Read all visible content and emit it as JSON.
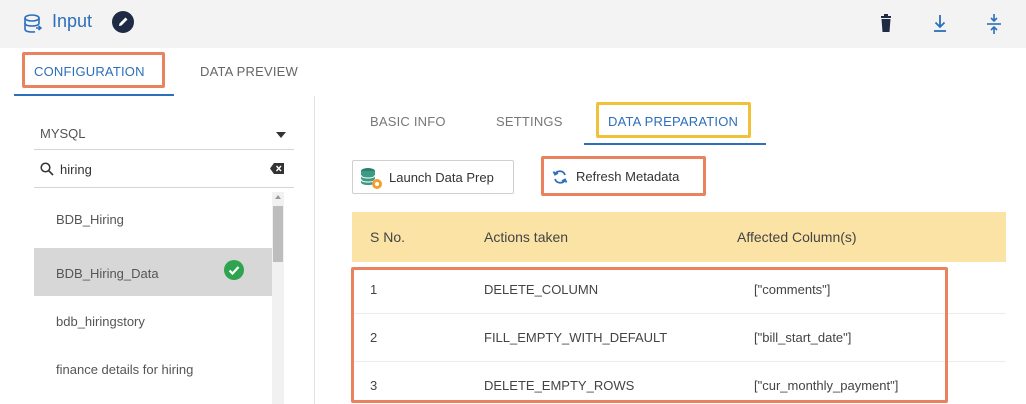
{
  "header": {
    "title": "Input",
    "icons": [
      "database-icon",
      "edit-icon",
      "trash-icon",
      "download-icon",
      "collapse-icon"
    ]
  },
  "top_tabs": [
    {
      "label": "CONFIGURATION",
      "active": true
    },
    {
      "label": "DATA PREVIEW",
      "active": false
    }
  ],
  "left": {
    "select_value": "MYSQL",
    "search_value": "hiring",
    "items": [
      {
        "label": "BDB_Hiring",
        "selected": false
      },
      {
        "label": "BDB_Hiring_Data",
        "selected": true
      },
      {
        "label": "bdb_hiringstory",
        "selected": false
      },
      {
        "label": "finance details for hiring",
        "selected": false
      }
    ]
  },
  "sub_tabs": [
    {
      "label": "BASIC INFO",
      "active": false
    },
    {
      "label": "SETTINGS",
      "active": false
    },
    {
      "label": "DATA PREPARATION",
      "active": true
    }
  ],
  "buttons": {
    "launch": "Launch Data Prep",
    "refresh": "Refresh Metadata"
  },
  "table": {
    "headers": [
      "S No.",
      "Actions taken",
      "Affected Column(s)"
    ],
    "rows": [
      [
        "1",
        "DELETE_COLUMN",
        "[\"comments\"]"
      ],
      [
        "2",
        "FILL_EMPTY_WITH_DEFAULT",
        "[\"bill_start_date\"]"
      ],
      [
        "3",
        "DELETE_EMPTY_ROWS",
        "[\"cur_monthly_payment\"]"
      ]
    ]
  },
  "colors": {
    "accent": "#2c6fbb",
    "highlight_orange": "#e8825f",
    "highlight_yellow": "#f0c23a",
    "table_header": "#fbe3a6",
    "success": "#2ea44f"
  }
}
